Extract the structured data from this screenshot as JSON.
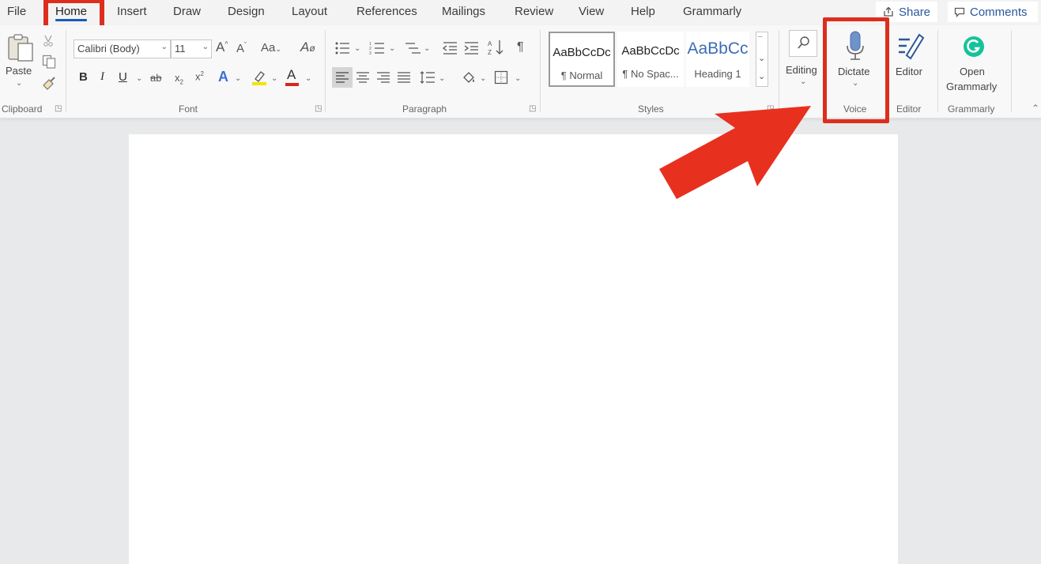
{
  "tabs": [
    "File",
    "Home",
    "Insert",
    "Draw",
    "Design",
    "Layout",
    "References",
    "Mailings",
    "Review",
    "View",
    "Help",
    "Grammarly"
  ],
  "active_tab": "Home",
  "share_label": "Share",
  "comments_label": "Comments",
  "clipboard": {
    "paste_label": "Paste",
    "group_label": "Clipboard"
  },
  "font": {
    "name": "Calibri (Body)",
    "size": "11",
    "group_label": "Font",
    "grow_label": "A",
    "case_label": "Aa"
  },
  "paragraph": {
    "group_label": "Paragraph"
  },
  "styles": {
    "group_label": "Styles",
    "items": [
      {
        "sample": "AaBbCcDc",
        "name": "¶ Normal"
      },
      {
        "sample": "AaBbCcDc",
        "name": "¶ No Spac..."
      },
      {
        "sample": "AaBbCc",
        "name": "Heading 1"
      }
    ]
  },
  "editing_label": "Editing",
  "voice": {
    "dictate_label": "Dictate",
    "group_label": "Voice"
  },
  "editor": {
    "label": "Editor",
    "group_label": "Editor"
  },
  "grammarly": {
    "button_line1": "Open",
    "button_line2": "Grammarly",
    "group_label": "Grammarly"
  },
  "colors": {
    "accent_red": "#dd2e1d",
    "word_blue": "#185abd",
    "grammarly_green": "#15c39a"
  }
}
